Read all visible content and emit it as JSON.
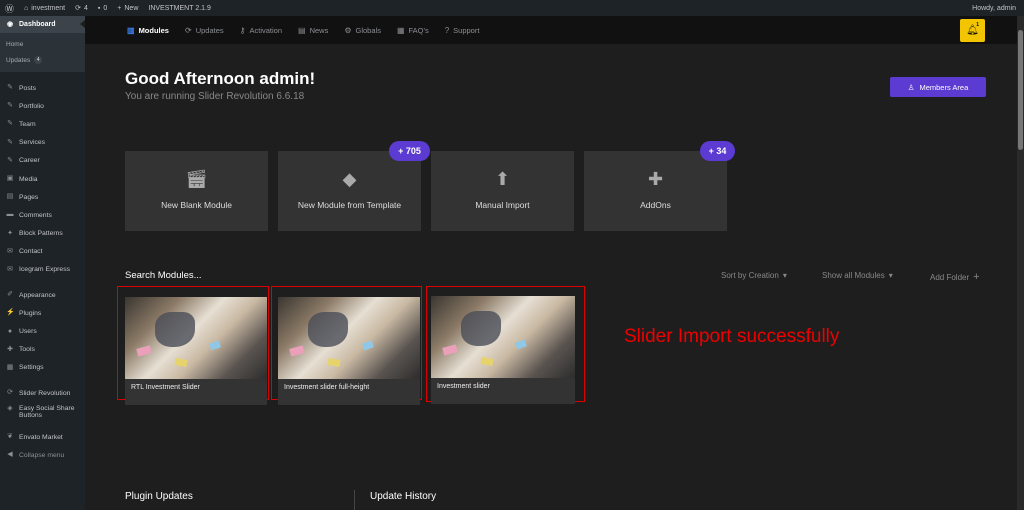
{
  "adminbar": {
    "site": "investment",
    "updates": "4",
    "comments": "0",
    "new": "New",
    "theme": "INVESTMENT 2.1.9",
    "howdy": "Howdy, admin"
  },
  "sidebar": {
    "dashboard": "Dashboard",
    "sub": {
      "home": "Home",
      "updates": "Updates",
      "updates_count": "4"
    },
    "items": [
      "Posts",
      "Portfolio",
      "Team",
      "Services",
      "Career",
      "Media",
      "Pages",
      "Comments",
      "Block Patterns",
      "Contact",
      "Icegram Express"
    ],
    "items2": [
      "Appearance",
      "Plugins",
      "Users",
      "Tools",
      "Settings"
    ],
    "items3": {
      "slider": "Slider Revolution",
      "share": "Easy Social Share Buttons",
      "envato": "Envato Market",
      "collapse": "Collapse menu"
    }
  },
  "topnav": {
    "modules": "Modules",
    "updates": "Updates",
    "activation": "Activation",
    "news": "News",
    "globals": "Globals",
    "faqs": "FAQ's",
    "support": "Support",
    "bell_count": "1"
  },
  "header": {
    "greeting": "Good Afternoon admin!",
    "running": "You are running Slider Revolution 6.6.18",
    "members": "Members Area"
  },
  "cards": {
    "blank": "New Blank Module",
    "template": "New Module from Template",
    "import": "Manual Import",
    "addons": "AddOns",
    "template_count": "+ 705",
    "addons_count": "+ 34"
  },
  "search": {
    "label": "Search Modules...",
    "sort": "Sort by Creation",
    "show": "Show all Modules",
    "add_folder": "Add Folder"
  },
  "modules": [
    "RTL Investment Slider",
    "Investment slider full-height",
    "Investment slider"
  ],
  "annotation": "Slider Import successfully",
  "footer": {
    "plugin_updates": "Plugin Updates",
    "update_history": "Update History"
  },
  "colors": {
    "accent": "#5b3bd1",
    "bell": "#f2c500",
    "highlight": "#dd0000"
  }
}
